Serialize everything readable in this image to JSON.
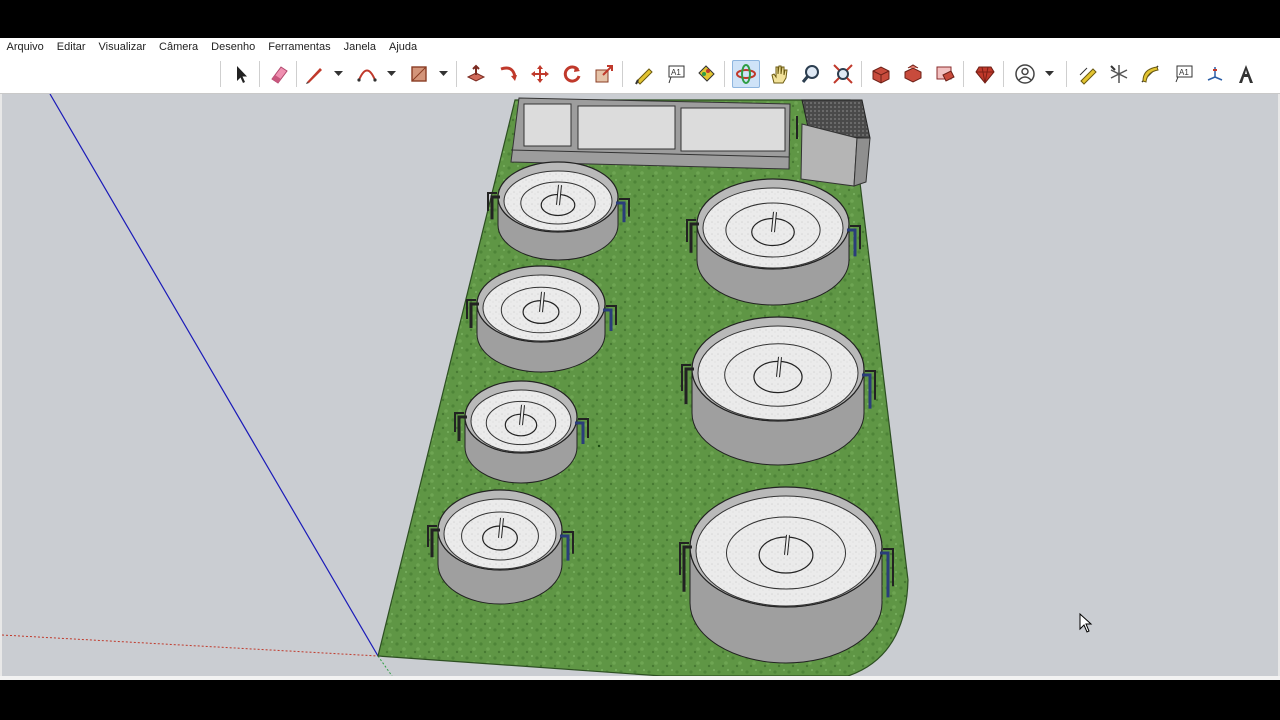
{
  "menu": {
    "items": [
      "Arquivo",
      "Editar",
      "Visualizar",
      "Câmera",
      "Desenho",
      "Ferramentas",
      "Janela",
      "Ajuda"
    ]
  },
  "toolbar": {
    "tools": [
      {
        "name": "select-tool-icon",
        "color": "#222222"
      },
      {
        "name": "eraser-tool-icon",
        "color": "#e8678a"
      },
      {
        "name": "pencil-line-tool-icon",
        "color": "#c0392b"
      },
      {
        "name": "arc-tool-icon",
        "color": "#c0392b"
      },
      {
        "name": "rectangle-tool-icon",
        "color": "#b85a3a"
      },
      {
        "name": "push-pull-tool-icon",
        "color": "#c0392b"
      },
      {
        "name": "follow-me-tool-icon",
        "color": "#c0392b"
      },
      {
        "name": "move-tool-icon",
        "color": "#c0392b"
      },
      {
        "name": "rotate-tool-icon",
        "color": "#c0392b"
      },
      {
        "name": "scale-tool-icon",
        "color": "#c0392b"
      },
      {
        "name": "tape-measure-tool-icon",
        "color": "#d4b21a"
      },
      {
        "name": "text-tool-icon",
        "color": "#333333"
      },
      {
        "name": "paint-bucket-tool-icon",
        "color": "#d4b21a"
      },
      {
        "name": "orbit-tool-icon",
        "color": "#c0392b"
      },
      {
        "name": "pan-tool-icon",
        "color": "#d4b21a"
      },
      {
        "name": "zoom-tool-icon",
        "color": "#2c3e50"
      },
      {
        "name": "zoom-extents-tool-icon",
        "color": "#c0392b"
      },
      {
        "name": "warehouse-tool-icon",
        "color": "#c0392b"
      },
      {
        "name": "components-tool-icon",
        "color": "#c0392b"
      },
      {
        "name": "extension-warehouse-tool-icon",
        "color": "#c0392b"
      },
      {
        "name": "ruby-tool-icon",
        "color": "#c0392b"
      },
      {
        "name": "account-tool-icon",
        "color": "#444444"
      },
      {
        "name": "dimension-tool-icon",
        "color": "#d4b21a"
      },
      {
        "name": "axes-tool-icon",
        "color": "#555555"
      },
      {
        "name": "protractor-tool-icon",
        "color": "#d4b21a"
      },
      {
        "name": "3d-text-tool-icon",
        "color": "#333333"
      },
      {
        "name": "section-plane-tool-icon",
        "color": "#2b5ea7"
      },
      {
        "name": "3d-text-a-tool-icon",
        "color": "#333333"
      }
    ]
  },
  "scene": {
    "background": "#cacdd2",
    "ground_color": "#5f9645",
    "tank_fill": "#e9e9e9",
    "tank_wall": "#9f9f9f"
  }
}
